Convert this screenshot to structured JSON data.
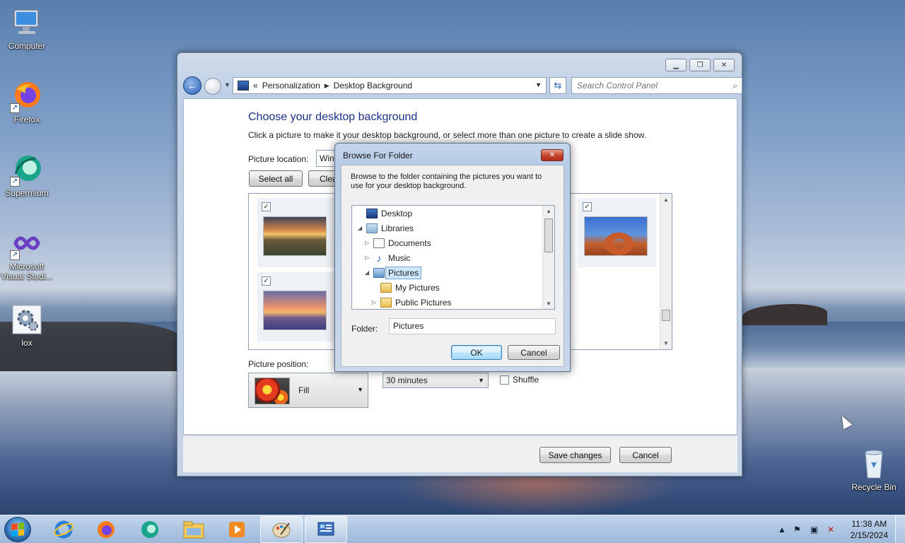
{
  "desktop": {
    "icons": [
      {
        "label": "Computer",
        "icon": "computer-icon"
      },
      {
        "label": "Firefox",
        "icon": "firefox-icon"
      },
      {
        "label": "Supermium",
        "icon": "supermium-icon"
      },
      {
        "label": "Microsoft Visual Studi...",
        "icon": "visual-studio-icon"
      },
      {
        "label": "lox",
        "icon": "settings-gear-icon"
      },
      {
        "label": "Recycle Bin",
        "icon": "recycle-bin-icon"
      }
    ]
  },
  "window": {
    "address": {
      "overflow": "«",
      "crumbs": [
        "Personalization",
        "Desktop Background"
      ]
    },
    "search_placeholder": "Search Control Panel",
    "title": "Choose your desktop background",
    "description": "Click a picture to make it your desktop background, or select more than one picture to create a slide show.",
    "picture_location_label": "Picture location:",
    "picture_location_value": "Wind",
    "select_all": "Select all",
    "clear_all": "Clea",
    "picture_position_label": "Picture position:",
    "picture_position_value": "Fill",
    "interval_value": "30 minutes",
    "shuffle_label": "Shuffle",
    "save_changes": "Save changes",
    "cancel": "Cancel"
  },
  "dialog": {
    "title": "Browse For Folder",
    "instructions": "Browse to the folder containing the pictures you want to use for your desktop background.",
    "tree": [
      {
        "label": "Desktop",
        "icon": "desktop-icon",
        "level": 0,
        "expander": ""
      },
      {
        "label": "Libraries",
        "icon": "libraries-icon",
        "level": 0,
        "expander": "◢"
      },
      {
        "label": "Documents",
        "icon": "documents-icon",
        "level": 1,
        "expander": "▷"
      },
      {
        "label": "Music",
        "icon": "music-icon",
        "level": 1,
        "expander": "▷"
      },
      {
        "label": "Pictures",
        "icon": "pictures-icon",
        "level": 1,
        "expander": "◢",
        "selected": true
      },
      {
        "label": "My Pictures",
        "icon": "folder-icon",
        "level": 2,
        "expander": ""
      },
      {
        "label": "Public Pictures",
        "icon": "folder-icon",
        "level": 2,
        "expander": "▷"
      }
    ],
    "folder_label": "Folder:",
    "folder_value": "Pictures",
    "ok": "OK",
    "cancel": "Cancel"
  },
  "taskbar": {
    "time": "11:38 AM",
    "date": "2/15/2024"
  }
}
